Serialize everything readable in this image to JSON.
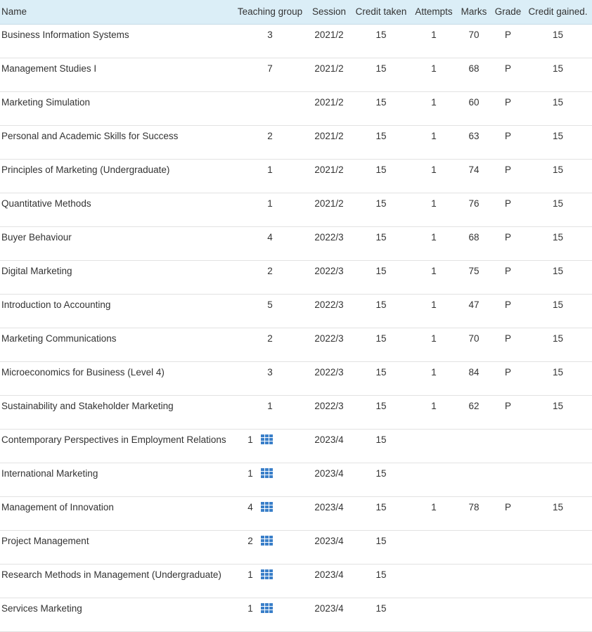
{
  "columns": {
    "name": "Name",
    "teaching_group": "Teaching group",
    "session": "Session",
    "credit_taken": "Credit taken",
    "attempts": "Attempts",
    "marks": "Marks",
    "grade": "Grade",
    "credit_gained": "Credit gained."
  },
  "icon_semantics": {
    "teaching_group_link": "teaching-group-grid-icon"
  },
  "colors": {
    "header_bg": "#dbeef7",
    "icon": "#3a7fc9"
  },
  "rows": [
    {
      "name": "Business Information Systems",
      "teaching_group": "3",
      "has_icon": false,
      "session": "2021/2",
      "credit_taken": "15",
      "attempts": "1",
      "marks": "70",
      "grade": "P",
      "credit_gained": "15"
    },
    {
      "name": "Management Studies I",
      "teaching_group": "7",
      "has_icon": false,
      "session": "2021/2",
      "credit_taken": "15",
      "attempts": "1",
      "marks": "68",
      "grade": "P",
      "credit_gained": "15"
    },
    {
      "name": "Marketing Simulation",
      "teaching_group": "",
      "has_icon": false,
      "session": "2021/2",
      "credit_taken": "15",
      "attempts": "1",
      "marks": "60",
      "grade": "P",
      "credit_gained": "15"
    },
    {
      "name": "Personal and Academic Skills for Success",
      "teaching_group": "2",
      "has_icon": false,
      "session": "2021/2",
      "credit_taken": "15",
      "attempts": "1",
      "marks": "63",
      "grade": "P",
      "credit_gained": "15"
    },
    {
      "name": "Principles of Marketing (Undergraduate)",
      "teaching_group": "1",
      "has_icon": false,
      "session": "2021/2",
      "credit_taken": "15",
      "attempts": "1",
      "marks": "74",
      "grade": "P",
      "credit_gained": "15"
    },
    {
      "name": "Quantitative Methods",
      "teaching_group": "1",
      "has_icon": false,
      "session": "2021/2",
      "credit_taken": "15",
      "attempts": "1",
      "marks": "76",
      "grade": "P",
      "credit_gained": "15"
    },
    {
      "name": "Buyer Behaviour",
      "teaching_group": "4",
      "has_icon": false,
      "session": "2022/3",
      "credit_taken": "15",
      "attempts": "1",
      "marks": "68",
      "grade": "P",
      "credit_gained": "15"
    },
    {
      "name": "Digital Marketing",
      "teaching_group": "2",
      "has_icon": false,
      "session": "2022/3",
      "credit_taken": "15",
      "attempts": "1",
      "marks": "75",
      "grade": "P",
      "credit_gained": "15"
    },
    {
      "name": "Introduction to Accounting",
      "teaching_group": "5",
      "has_icon": false,
      "session": "2022/3",
      "credit_taken": "15",
      "attempts": "1",
      "marks": "47",
      "grade": "P",
      "credit_gained": "15"
    },
    {
      "name": "Marketing Communications",
      "teaching_group": "2",
      "has_icon": false,
      "session": "2022/3",
      "credit_taken": "15",
      "attempts": "1",
      "marks": "70",
      "grade": "P",
      "credit_gained": "15"
    },
    {
      "name": "Microeconomics for Business (Level 4)",
      "teaching_group": "3",
      "has_icon": false,
      "session": "2022/3",
      "credit_taken": "15",
      "attempts": "1",
      "marks": "84",
      "grade": "P",
      "credit_gained": "15"
    },
    {
      "name": "Sustainability and Stakeholder Marketing",
      "teaching_group": "1",
      "has_icon": false,
      "session": "2022/3",
      "credit_taken": "15",
      "attempts": "1",
      "marks": "62",
      "grade": "P",
      "credit_gained": "15"
    },
    {
      "name": "Contemporary Perspectives in Employment Relations",
      "teaching_group": "1",
      "has_icon": true,
      "session": "2023/4",
      "credit_taken": "15",
      "attempts": "",
      "marks": "",
      "grade": "",
      "credit_gained": ""
    },
    {
      "name": "International Marketing",
      "teaching_group": "1",
      "has_icon": true,
      "session": "2023/4",
      "credit_taken": "15",
      "attempts": "",
      "marks": "",
      "grade": "",
      "credit_gained": ""
    },
    {
      "name": "Management of Innovation",
      "teaching_group": "4",
      "has_icon": true,
      "session": "2023/4",
      "credit_taken": "15",
      "attempts": "1",
      "marks": "78",
      "grade": "P",
      "credit_gained": "15"
    },
    {
      "name": "Project Management",
      "teaching_group": "2",
      "has_icon": true,
      "session": "2023/4",
      "credit_taken": "15",
      "attempts": "",
      "marks": "",
      "grade": "",
      "credit_gained": ""
    },
    {
      "name": "Research Methods in Management (Undergraduate)",
      "teaching_group": "1",
      "has_icon": true,
      "session": "2023/4",
      "credit_taken": "15",
      "attempts": "",
      "marks": "",
      "grade": "",
      "credit_gained": ""
    },
    {
      "name": "Services Marketing",
      "teaching_group": "1",
      "has_icon": true,
      "session": "2023/4",
      "credit_taken": "15",
      "attempts": "",
      "marks": "",
      "grade": "",
      "credit_gained": ""
    }
  ]
}
